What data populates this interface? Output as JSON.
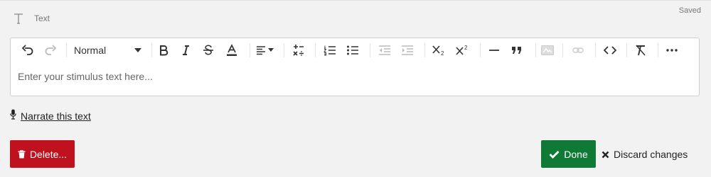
{
  "block": {
    "type_label": "Text",
    "status": "Saved"
  },
  "editor": {
    "format_value": "Normal",
    "placeholder": "Enter your stimulus text here..."
  },
  "narrate": {
    "label": "Narrate this text"
  },
  "actions": {
    "delete_label": "Delete...",
    "done_label": "Done",
    "discard_label": "Discard changes"
  },
  "colors": {
    "delete": "#c0111e",
    "done": "#0f7a36",
    "page_bg": "#f2f2f2"
  },
  "toolbar_icons": [
    "undo-icon",
    "redo-icon",
    "bold-icon",
    "italic-icon",
    "strikethrough-icon",
    "text-color-icon",
    "align-icon",
    "formula-icon",
    "ordered-list-icon",
    "bullet-list-icon",
    "outdent-icon",
    "indent-icon",
    "subscript-icon",
    "superscript-icon",
    "horizontal-rule-icon",
    "blockquote-icon",
    "image-icon",
    "link-icon",
    "code-icon",
    "clear-format-icon",
    "more-icon"
  ]
}
